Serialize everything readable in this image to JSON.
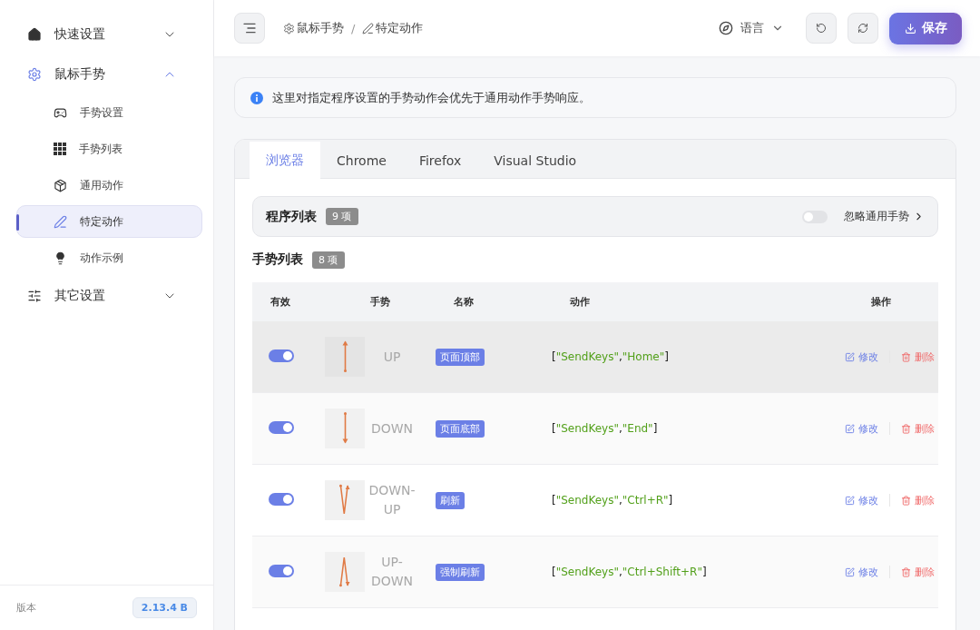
{
  "sidebar": {
    "groups": [
      {
        "label": "快速设置",
        "expanded": false
      },
      {
        "label": "鼠标手势",
        "expanded": true,
        "children": [
          {
            "label": "手势设置",
            "selected": false
          },
          {
            "label": "手势列表",
            "selected": false
          },
          {
            "label": "通用动作",
            "selected": false
          },
          {
            "label": "特定动作",
            "selected": true
          },
          {
            "label": "动作示例",
            "selected": false
          }
        ]
      },
      {
        "label": "其它设置",
        "expanded": false
      }
    ],
    "footer": {
      "label": "版本",
      "version": "2.13.4 B"
    }
  },
  "header": {
    "breadcrumb": [
      {
        "label": "鼠标手势"
      },
      {
        "label": "特定动作"
      }
    ],
    "separator": "/",
    "language": "语言",
    "save": "保存"
  },
  "notice": "这里对指定程序设置的手势动作会优先于通用动作手势响应。",
  "tabs": [
    {
      "label": "浏览器",
      "selected": true
    },
    {
      "label": "Chrome",
      "selected": false
    },
    {
      "label": "Firefox",
      "selected": false
    },
    {
      "label": "Visual Studio",
      "selected": false
    }
  ],
  "program_list": {
    "title": "程序列表",
    "count": "9 项",
    "ignore_label": "忽略通用手势",
    "ignore_on": false
  },
  "gesture_list": {
    "title": "手势列表",
    "count": "8 项"
  },
  "table": {
    "columns": [
      "有效",
      "手势",
      "名称",
      "动作",
      "操作"
    ],
    "rows": [
      {
        "enabled": true,
        "kind": "up",
        "gesture": "UP",
        "name": "页面顶部",
        "action": "[\"SendKeys\",\"Home\"]",
        "edit": "修改",
        "delete": "删除",
        "highlighted": true
      },
      {
        "enabled": true,
        "kind": "down",
        "gesture": "DOWN",
        "name": "页面底部",
        "action": "[\"SendKeys\",\"End\"]",
        "edit": "修改",
        "delete": "删除",
        "highlighted": false
      },
      {
        "enabled": true,
        "kind": "down-up",
        "gesture": "DOWN-UP",
        "name": "刷新",
        "action": "[\"SendKeys\",\"Ctrl+R\"]",
        "edit": "修改",
        "delete": "删除",
        "highlighted": false
      },
      {
        "enabled": true,
        "kind": "up-down",
        "gesture": "UP-DOWN",
        "name": "强制刷新",
        "action": "[\"SendKeys\",\"Ctrl+Shift+R\"]",
        "edit": "修改",
        "delete": "删除",
        "highlighted": false
      }
    ]
  }
}
